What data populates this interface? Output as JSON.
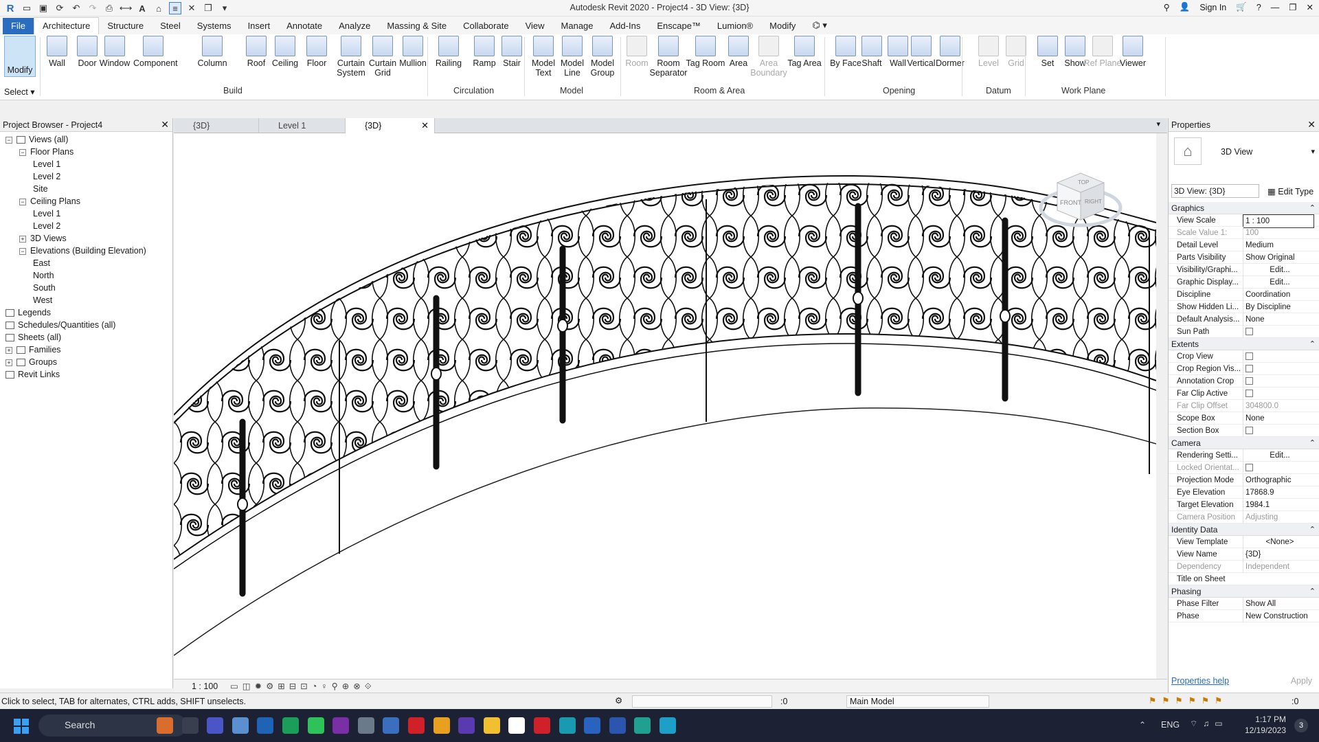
{
  "title_bar": {
    "title": "Autodesk Revit 2020 - Project4 - 3D View: {3D}",
    "sign_in": "Sign In"
  },
  "ribbon_tabs": [
    "File",
    "Architecture",
    "Structure",
    "Steel",
    "Systems",
    "Insert",
    "Annotate",
    "Analyze",
    "Massing & Site",
    "Collaborate",
    "View",
    "Manage",
    "Add-Ins",
    "Enscape™",
    "Lumion®",
    "Modify"
  ],
  "ribbon": {
    "modify_label": "Modify",
    "select_label": "Select",
    "buttons": [
      {
        "label": "Wall"
      },
      {
        "label": "Door"
      },
      {
        "label": "Window"
      },
      {
        "label": "Component"
      },
      {
        "label": "Column"
      },
      {
        "label": "Roof"
      },
      {
        "label": "Ceiling"
      },
      {
        "label": "Floor"
      },
      {
        "label": "Curtain System"
      },
      {
        "label": "Curtain Grid"
      },
      {
        "label": "Mullion"
      },
      {
        "label": "Railing"
      },
      {
        "label": "Ramp"
      },
      {
        "label": "Stair"
      },
      {
        "label": "Model Text"
      },
      {
        "label": "Model Line"
      },
      {
        "label": "Model Group"
      },
      {
        "label": "Room"
      },
      {
        "label": "Room Separator"
      },
      {
        "label": "Tag Room"
      },
      {
        "label": "Area"
      },
      {
        "label": "Area Boundary"
      },
      {
        "label": "Tag Area"
      },
      {
        "label": "By Face"
      },
      {
        "label": "Shaft"
      },
      {
        "label": "Wall"
      },
      {
        "label": "Vertical"
      },
      {
        "label": "Dormer"
      },
      {
        "label": "Level"
      },
      {
        "label": "Grid"
      },
      {
        "label": "Set"
      },
      {
        "label": "Show"
      },
      {
        "label": "Ref Plane"
      },
      {
        "label": "Viewer"
      }
    ],
    "panels": [
      "Build",
      "Circulation",
      "Model",
      "Room & Area",
      "Opening",
      "Datum",
      "Work Plane"
    ]
  },
  "project_browser": {
    "title": "Project Browser - Project4",
    "items": [
      {
        "label": "Views (all)"
      },
      {
        "label": "Floor Plans"
      },
      {
        "label": "Level 1"
      },
      {
        "label": "Level 2"
      },
      {
        "label": "Site"
      },
      {
        "label": "Ceiling Plans"
      },
      {
        "label": "Level 1"
      },
      {
        "label": "Level 2"
      },
      {
        "label": "3D Views"
      },
      {
        "label": "Elevations (Building Elevation)"
      },
      {
        "label": "East"
      },
      {
        "label": "North"
      },
      {
        "label": "South"
      },
      {
        "label": "West"
      },
      {
        "label": "Legends"
      },
      {
        "label": "Schedules/Quantities (all)"
      },
      {
        "label": "Sheets (all)"
      },
      {
        "label": "Families"
      },
      {
        "label": "Groups"
      },
      {
        "label": "Revit Links"
      }
    ]
  },
  "view_tabs": [
    {
      "label": "{3D}"
    },
    {
      "label": "Level 1"
    },
    {
      "label": "{3D}"
    }
  ],
  "view_control": {
    "scale": "1 : 100"
  },
  "viewcube": {
    "top": "TOP",
    "front": "FRONT",
    "right": "RIGHT"
  },
  "properties": {
    "title": "Properties",
    "type_name": "3D View",
    "selector": "3D View: {3D}",
    "edit_type": "Edit Type",
    "sections": {
      "graphics": "Graphics",
      "extents": "Extents",
      "camera": "Camera",
      "identity": "Identity Data",
      "phasing": "Phasing"
    },
    "rows": [
      {
        "k": "View Scale",
        "v": "1 : 100"
      },
      {
        "k": "Scale Value    1:",
        "v": "100"
      },
      {
        "k": "Detail Level",
        "v": "Medium"
      },
      {
        "k": "Parts Visibility",
        "v": "Show Original"
      },
      {
        "k": "Visibility/Graphi...",
        "v": "Edit..."
      },
      {
        "k": "Graphic Display...",
        "v": "Edit..."
      },
      {
        "k": "Discipline",
        "v": "Coordination"
      },
      {
        "k": "Show Hidden Li...",
        "v": "By Discipline"
      },
      {
        "k": "Default Analysis...",
        "v": "None"
      },
      {
        "k": "Sun Path",
        "v": ""
      },
      {
        "k": "Crop View",
        "v": ""
      },
      {
        "k": "Crop Region Vis...",
        "v": ""
      },
      {
        "k": "Annotation Crop",
        "v": ""
      },
      {
        "k": "Far Clip Active",
        "v": ""
      },
      {
        "k": "Far Clip Offset",
        "v": "304800.0"
      },
      {
        "k": "Scope Box",
        "v": "None"
      },
      {
        "k": "Section Box",
        "v": ""
      },
      {
        "k": "Rendering Setti...",
        "v": "Edit..."
      },
      {
        "k": "Locked Orientat...",
        "v": ""
      },
      {
        "k": "Projection Mode",
        "v": "Orthographic"
      },
      {
        "k": "Eye Elevation",
        "v": "17868.9"
      },
      {
        "k": "Target Elevation",
        "v": "1984.1"
      },
      {
        "k": "Camera Position",
        "v": "Adjusting"
      },
      {
        "k": "View Template",
        "v": "<None>"
      },
      {
        "k": "View Name",
        "v": "{3D}"
      },
      {
        "k": "Dependency",
        "v": "Independent"
      },
      {
        "k": "Title on Sheet",
        "v": ""
      },
      {
        "k": "Phase Filter",
        "v": "Show All"
      },
      {
        "k": "Phase",
        "v": "New Construction"
      }
    ],
    "help": "Properties help",
    "apply": "Apply"
  },
  "status_bar": {
    "message": "Click to select, TAB for alternates, CTRL adds, SHIFT unselects.",
    "workset_count": ":0",
    "model": "Main Model",
    "filter_count": ":0"
  },
  "taskbar": {
    "search": "Search",
    "lang": "ENG",
    "time": "1:17 PM",
    "date": "12/19/2023",
    "notif": "3"
  }
}
